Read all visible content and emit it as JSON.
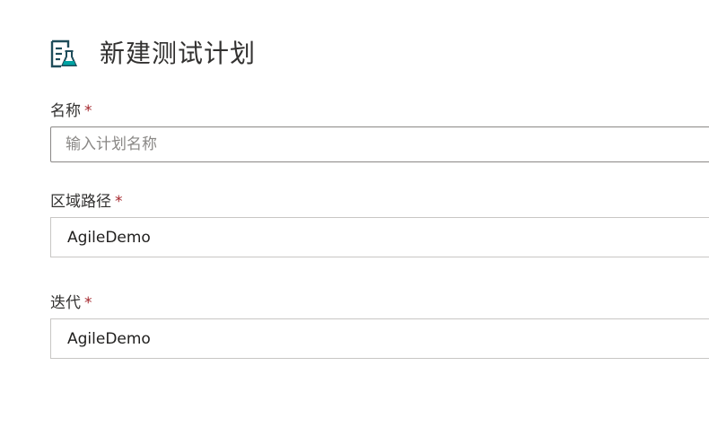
{
  "header": {
    "title": "新建测试计划",
    "icon": "test-plan-icon",
    "accent_color": "#1e4c5a",
    "flask_color": "#00a3a3"
  },
  "form": {
    "name": {
      "label": "名称",
      "required_mark": "*",
      "value": "",
      "placeholder": "输入计划名称"
    },
    "area_path": {
      "label": "区域路径",
      "required_mark": "*",
      "value": "AgileDemo"
    },
    "iteration": {
      "label": "迭代",
      "required_mark": "*",
      "value": "AgileDemo"
    }
  }
}
